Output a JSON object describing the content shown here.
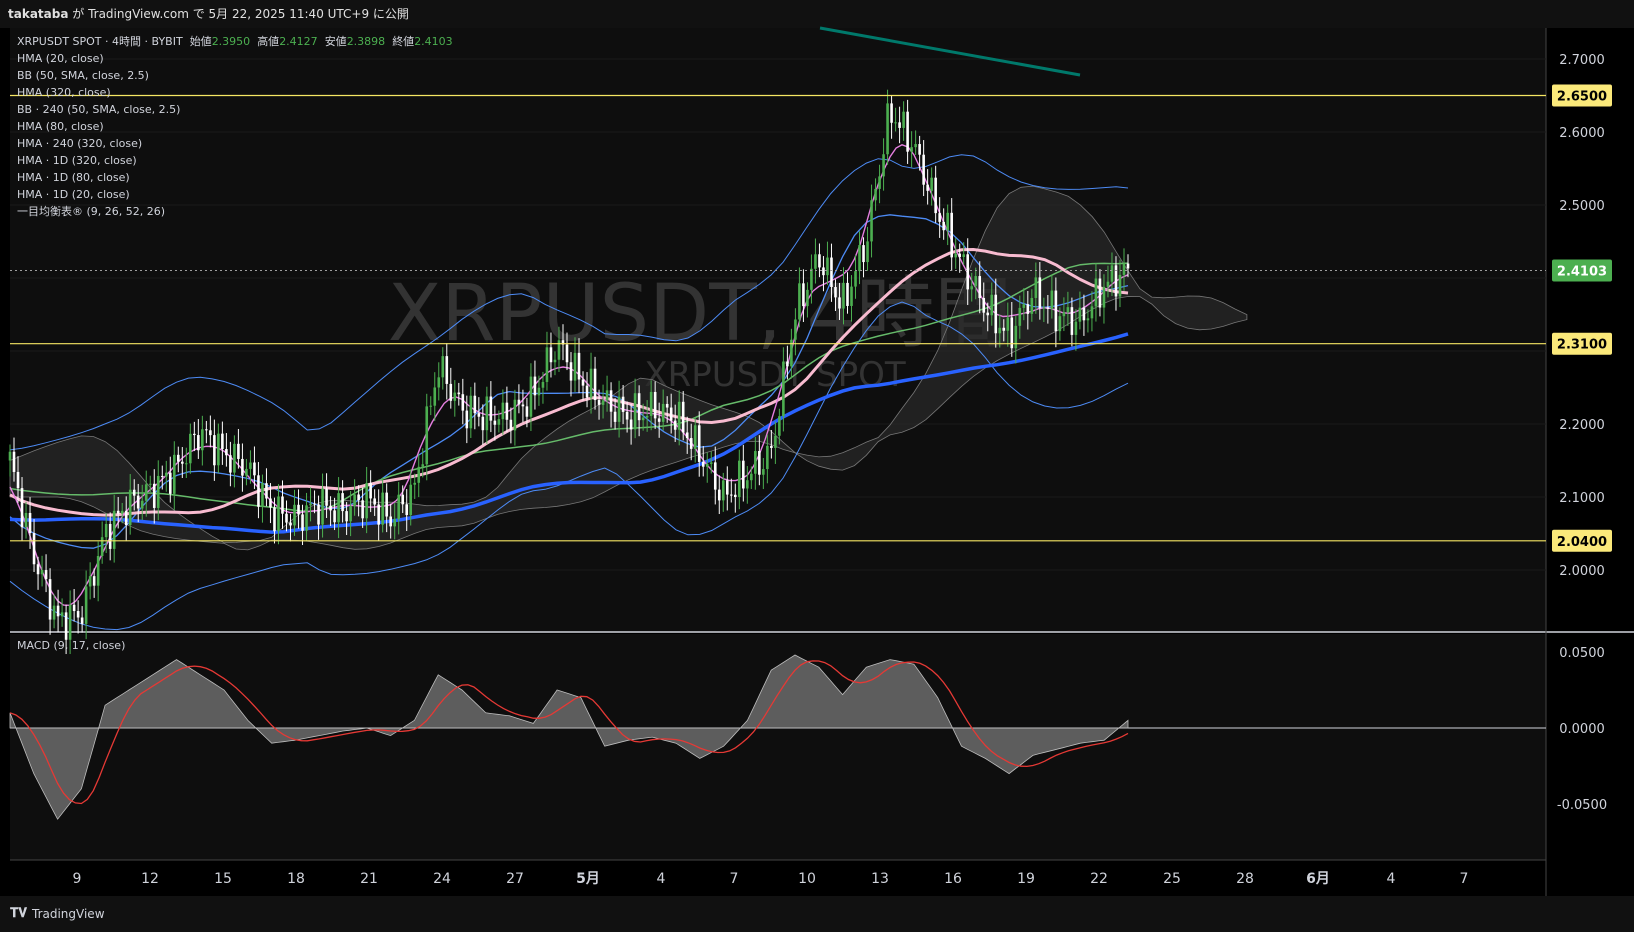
{
  "header": {
    "author": "takataba",
    "text": " が TradingView.com で 5月 22, 2025 11:40 UTC+9 に公開"
  },
  "footer": {
    "brand": "TradingView"
  },
  "legend": {
    "symbol": "XRPUSDT SPOT · 4時間 · BYBIT",
    "open_label": "始値",
    "open": "2.3950",
    "high_label": "高値",
    "high": "2.4127",
    "low_label": "安値",
    "low": "2.3898",
    "close_label": "終値",
    "close": "2.4103",
    "indicators": [
      "HMA (20, close)",
      "BB (50, SMA, close, 2.5)",
      "HMA (320, close)",
      "BB · 240 (50, SMA, close, 2.5)",
      "HMA (80, close)",
      "HMA · 240 (320, close)",
      "HMA · 1D (320, close)",
      "HMA · 1D (80, close)",
      "HMA · 1D (20, close)",
      "一目均衡表® (9, 26, 52, 26)"
    ]
  },
  "watermark": {
    "main": "XRPUSDT, 4時間",
    "sub": "XRPUSDT SPOT"
  },
  "macd_label": "MACD (9, 17, close)",
  "colors": {
    "background": "#000000",
    "panel": "#0e0e0e",
    "up": "#4caf50",
    "down": "#ffffff",
    "hline": "#f5e663",
    "hma_pink": "#f8bbd0",
    "hma_blue": "#2962ff",
    "hma_green": "#66bb6a",
    "hma_violet": "#e57fe0",
    "bb_blue": "#4d8bf5",
    "teal": "#00796b"
  },
  "chart_data": [
    {
      "type": "candlestick",
      "ylim": [
        1.92,
        2.76
      ],
      "y_ticks": [
        "2.7000",
        "2.6000",
        "2.5000",
        "2.2000",
        "2.1000",
        "2.0000"
      ],
      "x_ticks": [
        "9",
        "12",
        "15",
        "18",
        "21",
        "24",
        "27",
        "5月",
        "4",
        "7",
        "10",
        "13",
        "16",
        "19",
        "22",
        "25",
        "28",
        "6月",
        "4",
        "7"
      ],
      "horizontal_levels": [
        {
          "value": 2.65,
          "label": "2.6500"
        },
        {
          "value": 2.31,
          "label": "2.3100"
        },
        {
          "value": 2.04,
          "label": "2.0400"
        }
      ],
      "last_price": {
        "value": 2.4103,
        "label": "2.4103"
      },
      "price_path": [
        [
          0,
          2.15
        ],
        [
          1,
          2.02
        ],
        [
          2,
          1.93
        ],
        [
          3,
          1.94
        ],
        [
          4,
          2.05
        ],
        [
          5,
          2.09
        ],
        [
          6,
          2.11
        ],
        [
          7,
          2.14
        ],
        [
          8,
          2.19
        ],
        [
          9,
          2.16
        ],
        [
          10,
          2.14
        ],
        [
          11,
          2.08
        ],
        [
          12,
          2.07
        ],
        [
          13,
          2.09
        ],
        [
          14,
          2.08
        ],
        [
          15,
          2.1
        ],
        [
          16,
          2.07
        ],
        [
          17,
          2.11
        ],
        [
          18,
          2.28
        ],
        [
          19,
          2.22
        ],
        [
          20,
          2.21
        ],
        [
          21,
          2.21
        ],
        [
          22,
          2.24
        ],
        [
          23,
          2.31
        ],
        [
          24,
          2.26
        ],
        [
          25,
          2.23
        ],
        [
          26,
          2.21
        ],
        [
          27,
          2.22
        ],
        [
          28,
          2.21
        ],
        [
          29,
          2.16
        ],
        [
          30,
          2.1
        ],
        [
          31,
          2.13
        ],
        [
          32,
          2.16
        ],
        [
          33,
          2.35
        ],
        [
          34,
          2.43
        ],
        [
          35,
          2.36
        ],
        [
          36,
          2.45
        ],
        [
          37,
          2.63
        ],
        [
          38,
          2.58
        ],
        [
          39,
          2.49
        ],
        [
          40,
          2.42
        ],
        [
          41,
          2.36
        ],
        [
          42,
          2.32
        ],
        [
          43,
          2.38
        ],
        [
          44,
          2.35
        ],
        [
          45,
          2.34
        ],
        [
          46,
          2.39
        ],
        [
          47,
          2.41
        ]
      ],
      "macd": {
        "ylim": [
          -0.075,
          0.06
        ],
        "y_ticks": [
          "0.0500",
          "0.0000",
          "-0.0500"
        ],
        "hist_path": [
          [
            0,
            0.01
          ],
          [
            1,
            -0.03
          ],
          [
            2,
            -0.06
          ],
          [
            3,
            -0.04
          ],
          [
            4,
            0.015
          ],
          [
            5,
            0.025
          ],
          [
            6,
            0.035
          ],
          [
            7,
            0.045
          ],
          [
            8,
            0.035
          ],
          [
            9,
            0.025
          ],
          [
            10,
            0.005
          ],
          [
            11,
            -0.01
          ],
          [
            12,
            -0.008
          ],
          [
            13,
            -0.005
          ],
          [
            14,
            -0.002
          ],
          [
            15,
            0.0
          ],
          [
            16,
            -0.005
          ],
          [
            17,
            0.005
          ],
          [
            18,
            0.035
          ],
          [
            19,
            0.025
          ],
          [
            20,
            0.01
          ],
          [
            21,
            0.008
          ],
          [
            22,
            0.003
          ],
          [
            23,
            0.025
          ],
          [
            24,
            0.02
          ],
          [
            25,
            -0.012
          ],
          [
            26,
            -0.008
          ],
          [
            27,
            -0.006
          ],
          [
            28,
            -0.01
          ],
          [
            29,
            -0.02
          ],
          [
            30,
            -0.012
          ],
          [
            31,
            0.005
          ],
          [
            32,
            0.038
          ],
          [
            33,
            0.048
          ],
          [
            34,
            0.04
          ],
          [
            35,
            0.022
          ],
          [
            36,
            0.04
          ],
          [
            37,
            0.045
          ],
          [
            38,
            0.042
          ],
          [
            39,
            0.02
          ],
          [
            40,
            -0.012
          ],
          [
            41,
            -0.02
          ],
          [
            42,
            -0.03
          ],
          [
            43,
            -0.018
          ],
          [
            44,
            -0.014
          ],
          [
            45,
            -0.01
          ],
          [
            46,
            -0.008
          ],
          [
            47,
            0.005
          ]
        ]
      }
    }
  ]
}
